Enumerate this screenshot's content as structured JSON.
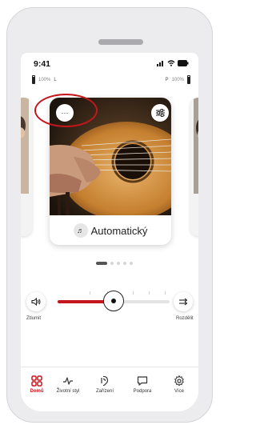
{
  "status_bar": {
    "time": "9:41"
  },
  "battery": {
    "left": {
      "percent": "100%",
      "side": "L",
      "level": 1.0
    },
    "right": {
      "percent": "100%",
      "side": "P",
      "level": 1.0
    }
  },
  "card": {
    "program_label": "Automatický",
    "program_icon": "music-note-icon",
    "more_glyph": "···",
    "photo": "acoustic-guitar-photo"
  },
  "pager": {
    "pages": 5,
    "active_index": 0
  },
  "volume": {
    "mute_label": "Ztlumit",
    "split_label": "Rozdělit",
    "level": 0.5
  },
  "tabs": [
    {
      "label": "Domů",
      "icon": "grid-icon",
      "active": true
    },
    {
      "label": "Životní styl",
      "icon": "activity-icon",
      "active": false
    },
    {
      "label": "Zařízení",
      "icon": "hearing-aid-icon",
      "active": false
    },
    {
      "label": "Podpora",
      "icon": "chat-icon",
      "active": false
    },
    {
      "label": "Více",
      "icon": "gear-icon",
      "active": false
    }
  ],
  "colors": {
    "accent": "#c4161c",
    "text": "#222222",
    "frame": "#ececef"
  }
}
